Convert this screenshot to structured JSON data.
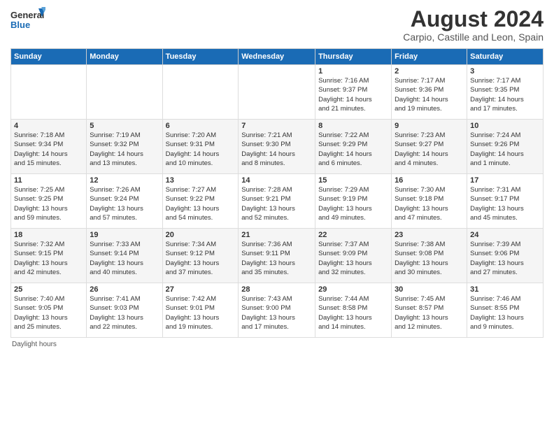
{
  "header": {
    "logo_line1": "General",
    "logo_line2": "Blue",
    "main_title": "August 2024",
    "subtitle": "Carpio, Castille and Leon, Spain"
  },
  "weekdays": [
    "Sunday",
    "Monday",
    "Tuesday",
    "Wednesday",
    "Thursday",
    "Friday",
    "Saturday"
  ],
  "footer": {
    "note": "Daylight hours"
  },
  "weeks": [
    [
      {
        "day": "",
        "info": ""
      },
      {
        "day": "",
        "info": ""
      },
      {
        "day": "",
        "info": ""
      },
      {
        "day": "",
        "info": ""
      },
      {
        "day": "1",
        "info": "Sunrise: 7:16 AM\nSunset: 9:37 PM\nDaylight: 14 hours\nand 21 minutes."
      },
      {
        "day": "2",
        "info": "Sunrise: 7:17 AM\nSunset: 9:36 PM\nDaylight: 14 hours\nand 19 minutes."
      },
      {
        "day": "3",
        "info": "Sunrise: 7:17 AM\nSunset: 9:35 PM\nDaylight: 14 hours\nand 17 minutes."
      }
    ],
    [
      {
        "day": "4",
        "info": "Sunrise: 7:18 AM\nSunset: 9:34 PM\nDaylight: 14 hours\nand 15 minutes."
      },
      {
        "day": "5",
        "info": "Sunrise: 7:19 AM\nSunset: 9:32 PM\nDaylight: 14 hours\nand 13 minutes."
      },
      {
        "day": "6",
        "info": "Sunrise: 7:20 AM\nSunset: 9:31 PM\nDaylight: 14 hours\nand 10 minutes."
      },
      {
        "day": "7",
        "info": "Sunrise: 7:21 AM\nSunset: 9:30 PM\nDaylight: 14 hours\nand 8 minutes."
      },
      {
        "day": "8",
        "info": "Sunrise: 7:22 AM\nSunset: 9:29 PM\nDaylight: 14 hours\nand 6 minutes."
      },
      {
        "day": "9",
        "info": "Sunrise: 7:23 AM\nSunset: 9:27 PM\nDaylight: 14 hours\nand 4 minutes."
      },
      {
        "day": "10",
        "info": "Sunrise: 7:24 AM\nSunset: 9:26 PM\nDaylight: 14 hours\nand 1 minute."
      }
    ],
    [
      {
        "day": "11",
        "info": "Sunrise: 7:25 AM\nSunset: 9:25 PM\nDaylight: 13 hours\nand 59 minutes."
      },
      {
        "day": "12",
        "info": "Sunrise: 7:26 AM\nSunset: 9:24 PM\nDaylight: 13 hours\nand 57 minutes."
      },
      {
        "day": "13",
        "info": "Sunrise: 7:27 AM\nSunset: 9:22 PM\nDaylight: 13 hours\nand 54 minutes."
      },
      {
        "day": "14",
        "info": "Sunrise: 7:28 AM\nSunset: 9:21 PM\nDaylight: 13 hours\nand 52 minutes."
      },
      {
        "day": "15",
        "info": "Sunrise: 7:29 AM\nSunset: 9:19 PM\nDaylight: 13 hours\nand 49 minutes."
      },
      {
        "day": "16",
        "info": "Sunrise: 7:30 AM\nSunset: 9:18 PM\nDaylight: 13 hours\nand 47 minutes."
      },
      {
        "day": "17",
        "info": "Sunrise: 7:31 AM\nSunset: 9:17 PM\nDaylight: 13 hours\nand 45 minutes."
      }
    ],
    [
      {
        "day": "18",
        "info": "Sunrise: 7:32 AM\nSunset: 9:15 PM\nDaylight: 13 hours\nand 42 minutes."
      },
      {
        "day": "19",
        "info": "Sunrise: 7:33 AM\nSunset: 9:14 PM\nDaylight: 13 hours\nand 40 minutes."
      },
      {
        "day": "20",
        "info": "Sunrise: 7:34 AM\nSunset: 9:12 PM\nDaylight: 13 hours\nand 37 minutes."
      },
      {
        "day": "21",
        "info": "Sunrise: 7:36 AM\nSunset: 9:11 PM\nDaylight: 13 hours\nand 35 minutes."
      },
      {
        "day": "22",
        "info": "Sunrise: 7:37 AM\nSunset: 9:09 PM\nDaylight: 13 hours\nand 32 minutes."
      },
      {
        "day": "23",
        "info": "Sunrise: 7:38 AM\nSunset: 9:08 PM\nDaylight: 13 hours\nand 30 minutes."
      },
      {
        "day": "24",
        "info": "Sunrise: 7:39 AM\nSunset: 9:06 PM\nDaylight: 13 hours\nand 27 minutes."
      }
    ],
    [
      {
        "day": "25",
        "info": "Sunrise: 7:40 AM\nSunset: 9:05 PM\nDaylight: 13 hours\nand 25 minutes."
      },
      {
        "day": "26",
        "info": "Sunrise: 7:41 AM\nSunset: 9:03 PM\nDaylight: 13 hours\nand 22 minutes."
      },
      {
        "day": "27",
        "info": "Sunrise: 7:42 AM\nSunset: 9:01 PM\nDaylight: 13 hours\nand 19 minutes."
      },
      {
        "day": "28",
        "info": "Sunrise: 7:43 AM\nSunset: 9:00 PM\nDaylight: 13 hours\nand 17 minutes."
      },
      {
        "day": "29",
        "info": "Sunrise: 7:44 AM\nSunset: 8:58 PM\nDaylight: 13 hours\nand 14 minutes."
      },
      {
        "day": "30",
        "info": "Sunrise: 7:45 AM\nSunset: 8:57 PM\nDaylight: 13 hours\nand 12 minutes."
      },
      {
        "day": "31",
        "info": "Sunrise: 7:46 AM\nSunset: 8:55 PM\nDaylight: 13 hours\nand 9 minutes."
      }
    ]
  ]
}
